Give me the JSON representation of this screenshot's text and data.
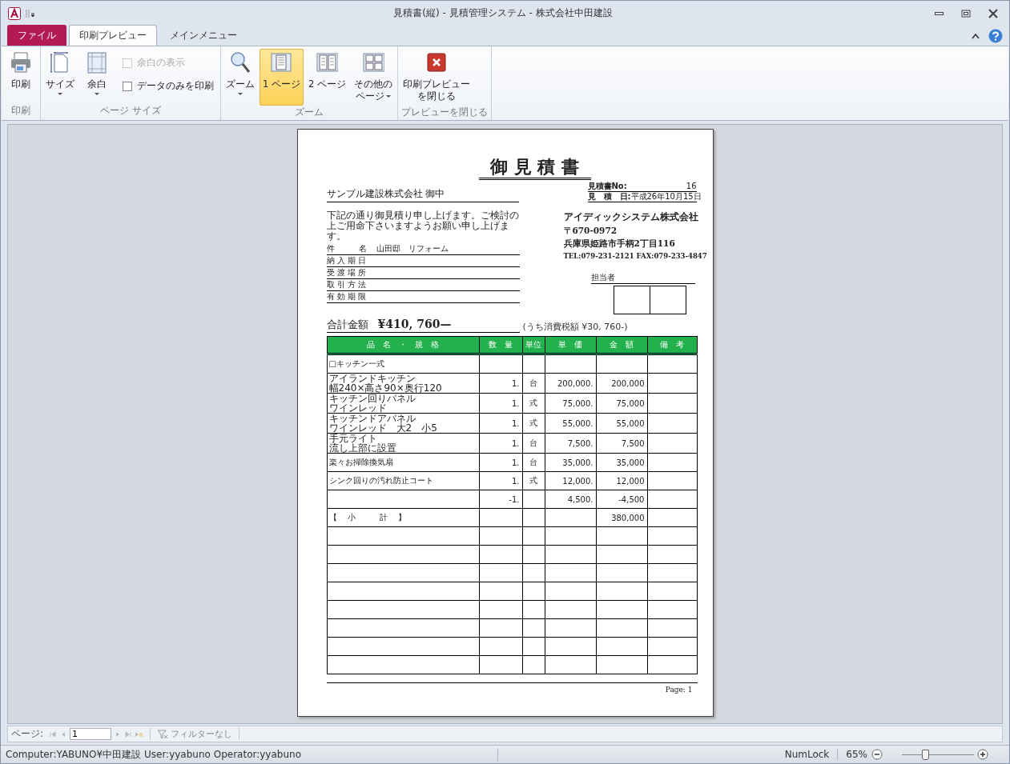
{
  "window": {
    "title": "見積書(縦) - 見積管理システム - 株式会社中田建設"
  },
  "ribbon_tabs": [
    {
      "label": "ファイル",
      "kind": "file",
      "selected": false
    },
    {
      "label": "印刷プレビュー",
      "kind": "tab",
      "selected": true
    },
    {
      "label": "メインメニュー",
      "kind": "tab",
      "selected": false
    }
  ],
  "ribbon_groups": [
    {
      "label": "印刷",
      "items": [
        {
          "kind": "button",
          "lines": [
            "印刷"
          ],
          "dropdown": false,
          "selected": false
        }
      ]
    },
    {
      "label": "ページ サイズ",
      "items": [
        {
          "kind": "button",
          "lines": [
            "サイズ"
          ],
          "dropdown": true,
          "selected": false
        },
        {
          "kind": "button",
          "lines": [
            "余白"
          ],
          "dropdown": true,
          "selected": false
        },
        {
          "kind": "checkbox",
          "label": "余白の表示",
          "checked": false,
          "disabled": true
        },
        {
          "kind": "checkbox",
          "label": "データのみを印刷",
          "checked": false,
          "disabled": false
        }
      ]
    },
    {
      "label": "ズーム",
      "items": [
        {
          "kind": "button",
          "lines": [
            "ズーム"
          ],
          "dropdown": true,
          "selected": false
        },
        {
          "kind": "button",
          "lines": [
            "1 ページ"
          ],
          "dropdown": false,
          "selected": true
        },
        {
          "kind": "button",
          "lines": [
            "2 ページ"
          ],
          "dropdown": false,
          "selected": false
        },
        {
          "kind": "button",
          "lines": [
            "その他の",
            "ページ"
          ],
          "dropdown": true,
          "selected": false
        }
      ]
    },
    {
      "label": "プレビューを閉じる",
      "items": [
        {
          "kind": "button",
          "lines": [
            "印刷プレビュー",
            "を閉じる"
          ],
          "dropdown": false,
          "selected": false
        }
      ]
    }
  ],
  "document": {
    "title": "御 見 積 書",
    "recipient": "サンプル建設株式会社 御中",
    "estimate_no_label": "見積書No:",
    "estimate_no": "16",
    "date_label": "見　積　日:",
    "date": "平成26年10月15日",
    "intro": "下記の通り御見積り申し上げます。ご検討の上ご用命下さいますようお願い申し上げます。",
    "fields": [
      {
        "label": "件　　　名",
        "value": "山田邸　リフォーム"
      },
      {
        "label": "納 入 期 日"
      },
      {
        "label": "受 渡 場 所"
      },
      {
        "label": "取 引 方 法"
      },
      {
        "label": "有 効 期 限"
      }
    ],
    "company": {
      "name": "アイディックシステム株式会社",
      "postal": "〒670-0972",
      "address": "兵庫県姫路市手柄2丁目116",
      "phone": "TEL:079-231-2121  FAX:079-233-4847"
    },
    "person_label": "担当者",
    "total_label": "合計金額",
    "total": "¥410, 760—",
    "tax_note": "(うち消費税額 ¥30, 760-)",
    "table": {
      "columns": [
        "品　名　・　規　格",
        "数　量",
        "単位",
        "単　価",
        "金　額",
        "備　考"
      ],
      "rows": [
        {
          "name": [
            "□キッチン一式"
          ]
        },
        {
          "name": [
            "アイランドキッチン",
            "幅240×高さ90×奥行120"
          ],
          "qty": "1.",
          "unit": "台",
          "price": "200,000.",
          "amount": "200,000"
        },
        {
          "name": [
            "キッチン回りパネル",
            "ワインレッド"
          ],
          "qty": "1.",
          "unit": "式",
          "price": "75,000.",
          "amount": "75,000"
        },
        {
          "name": [
            "キッチンドアパネル",
            "ワインレッド　大2　小5"
          ],
          "qty": "1.",
          "unit": "式",
          "price": "55,000.",
          "amount": "55,000"
        },
        {
          "name": [
            "手元ライト",
            "流し上部に設置"
          ],
          "qty": "1.",
          "unit": "台",
          "price": "7,500.",
          "amount": "7,500"
        },
        {
          "name": [
            "楽々お掃除換気扇"
          ],
          "qty": "1.",
          "unit": "台",
          "price": "35,000.",
          "amount": "35,000"
        },
        {
          "name": [
            "シンク回りの汚れ防止コート"
          ],
          "qty": "1.",
          "unit": "式",
          "price": "12,000.",
          "amount": "12,000"
        },
        {
          "qty": "-1.",
          "price": "4,500.",
          "amount": "-4,500"
        },
        {
          "name": [
            "【　 小　　　計　 】"
          ],
          "amount": "380,000"
        }
      ]
    },
    "page_label": "Page:  1"
  },
  "nav_bar": {
    "label": "ページ:",
    "page": "1",
    "filter": "フィルターなし"
  },
  "status_bar": {
    "text": "Computer:YABUNO¥中田建設 User:yyabuno Operator:yyabuno",
    "numlock": "NumLock",
    "zoom": "65%",
    "level": 0.32
  }
}
